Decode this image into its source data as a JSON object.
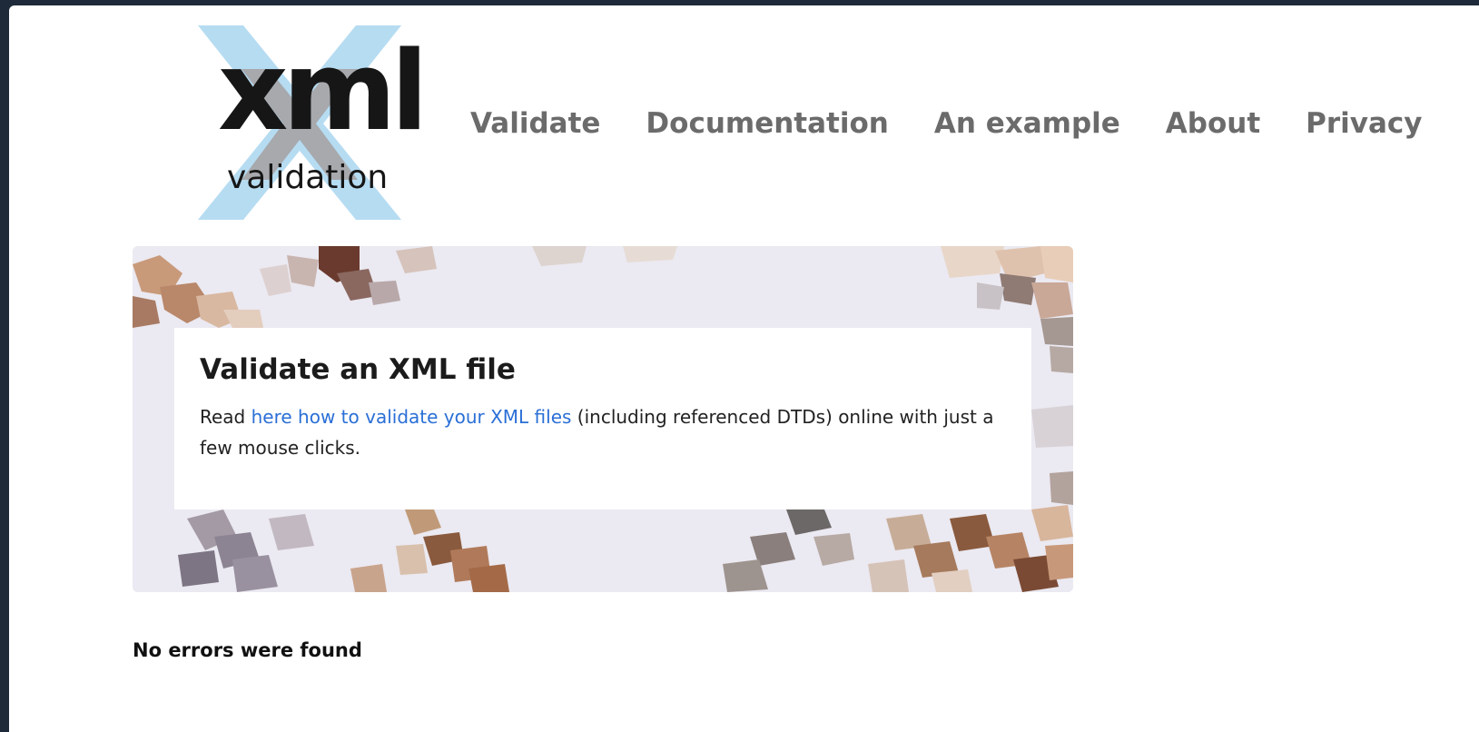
{
  "logo": {
    "main": "xml",
    "sub": "validation"
  },
  "nav": {
    "items": [
      {
        "label": "Validate"
      },
      {
        "label": "Documentation"
      },
      {
        "label": "An example"
      },
      {
        "label": "About"
      },
      {
        "label": "Privacy"
      }
    ]
  },
  "hero": {
    "title": "Validate an XML file",
    "text_before": "Read ",
    "link_text": "here how to validate your XML files",
    "text_after": " (including referenced DTDs) online with just a few mouse clicks."
  },
  "status": {
    "message": "No errors were found"
  },
  "colors": {
    "page_frame": "#1e2a3a",
    "nav_text": "#6b6b6b",
    "link": "#2a6fd6",
    "logo_x": "#b6dcf2"
  }
}
